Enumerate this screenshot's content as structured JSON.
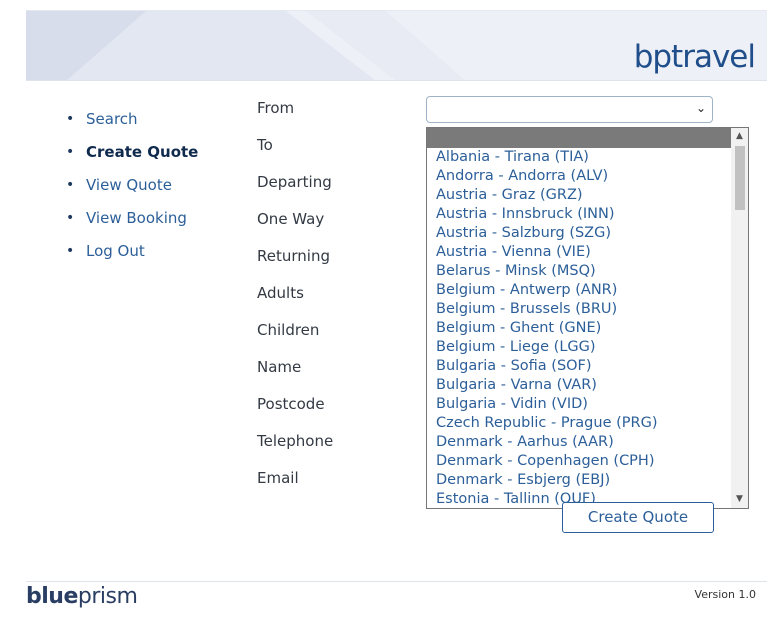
{
  "header": {
    "brand": "bptravel"
  },
  "nav": {
    "items": [
      {
        "label": "Search"
      },
      {
        "label": "Create Quote"
      },
      {
        "label": "View Quote"
      },
      {
        "label": "View Booking"
      },
      {
        "label": "Log Out"
      }
    ],
    "active": "Create Quote"
  },
  "form": {
    "labels": [
      "From",
      "To",
      "Departing",
      "One Way",
      "Returning",
      "Adults",
      "Children",
      "Name",
      "Postcode",
      "Telephone",
      "Email"
    ],
    "from_value": "",
    "submit_label": "Create Quote"
  },
  "dropdown": {
    "options": [
      "Albania - Tirana (TIA)",
      "Andorra - Andorra (ALV)",
      "Austria - Graz (GRZ)",
      "Austria - Innsbruck (INN)",
      "Austria - Salzburg (SZG)",
      "Austria - Vienna (VIE)",
      "Belarus - Minsk (MSQ)",
      "Belgium - Antwerp (ANR)",
      "Belgium - Brussels (BRU)",
      "Belgium - Ghent (GNE)",
      "Belgium - Liege (LGG)",
      "Bulgaria - Sofia (SOF)",
      "Bulgaria - Varna (VAR)",
      "Bulgaria - Vidin (VID)",
      "Czech Republic - Prague (PRG)",
      "Denmark - Aarhus (AAR)",
      "Denmark - Copenhagen (CPH)",
      "Denmark - Esbjerg (EBJ)",
      "Estonia - Tallinn (QUF)"
    ]
  },
  "footer": {
    "logo_part1": "blue",
    "logo_part2": "prism",
    "version": "Version 1.0"
  },
  "icons": {
    "select_arrow": "chevron-down-icon",
    "scroll_up": "scroll-up-icon",
    "scroll_down": "scroll-down-icon"
  },
  "colors": {
    "brand": "#1f4e8a",
    "link": "#2c5f99",
    "selected_option": "#7a7a7a"
  }
}
